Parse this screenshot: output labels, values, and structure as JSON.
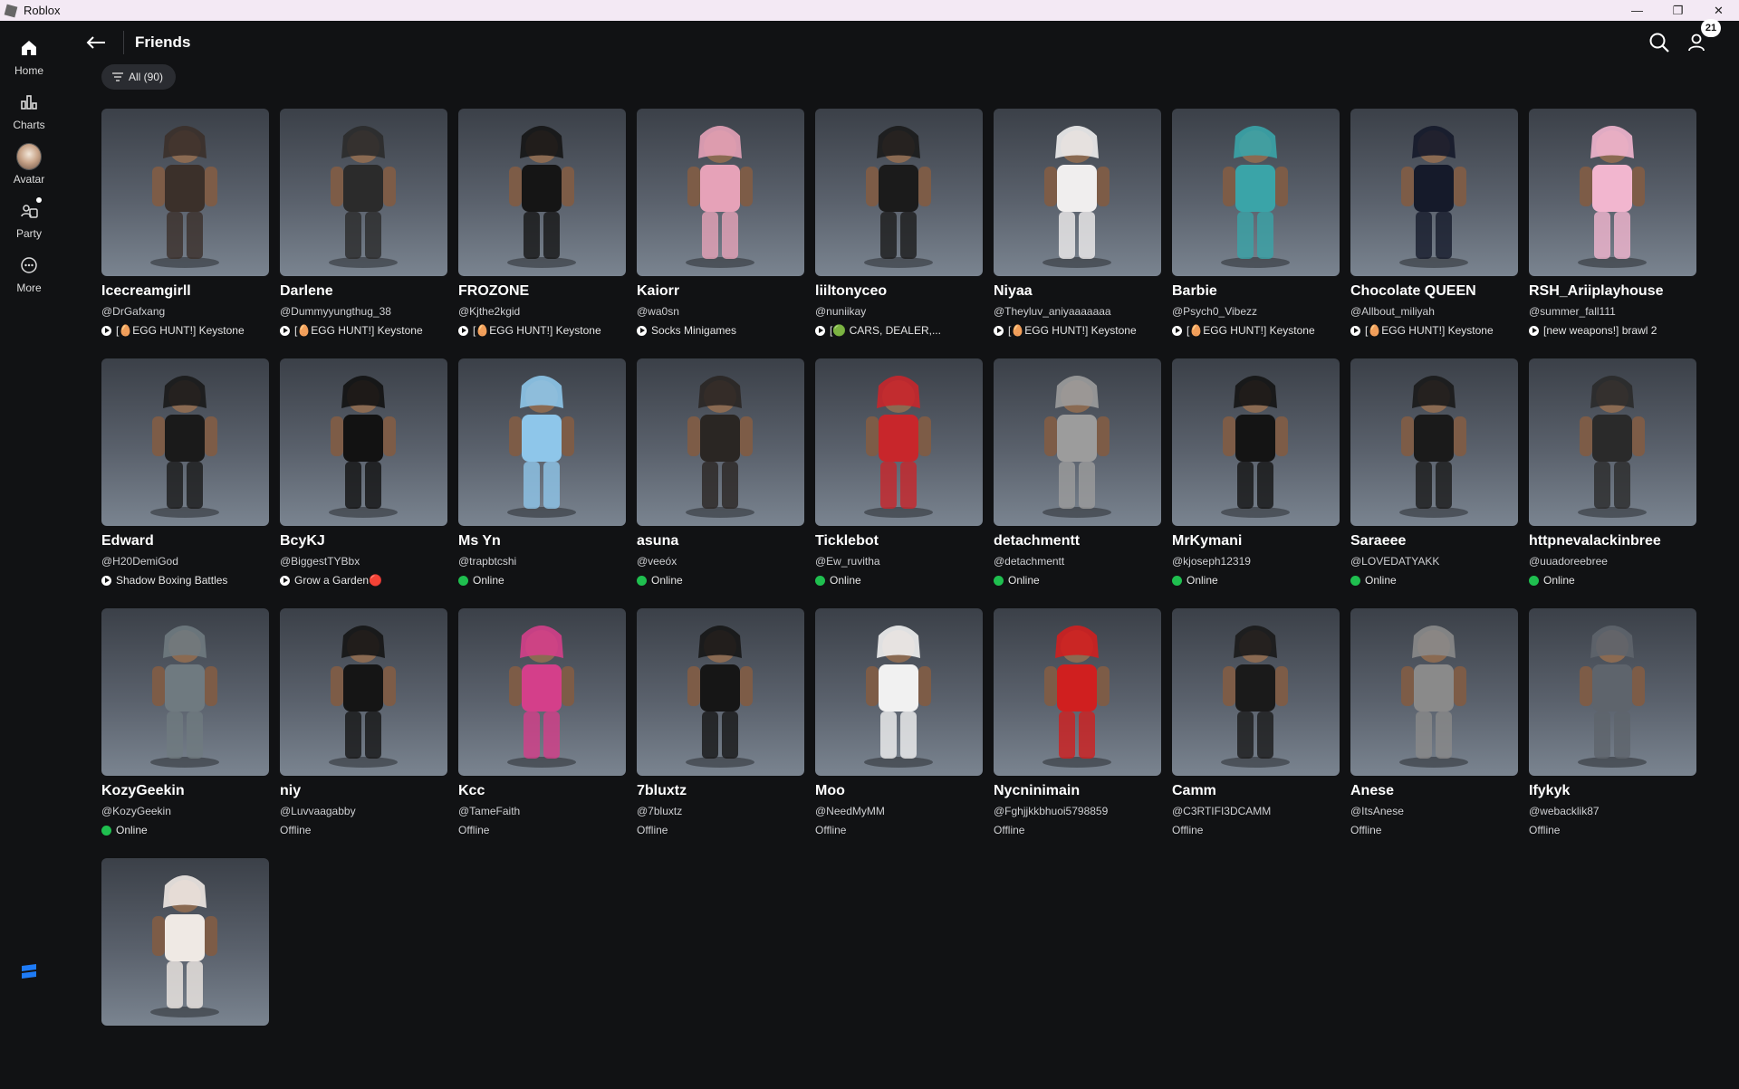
{
  "window": {
    "title": "Roblox",
    "controls": [
      "—",
      "❐",
      "✕"
    ]
  },
  "sidebar": {
    "items": [
      {
        "id": "home",
        "label": "Home",
        "icon": "home-icon"
      },
      {
        "id": "charts",
        "label": "Charts",
        "icon": "charts-icon"
      },
      {
        "id": "avatar",
        "label": "Avatar",
        "icon": "avatar-icon"
      },
      {
        "id": "party",
        "label": "Party",
        "icon": "party-icon"
      },
      {
        "id": "more",
        "label": "More",
        "icon": "more-icon"
      }
    ]
  },
  "header": {
    "title": "Friends",
    "notification_count": "21"
  },
  "filter": {
    "label": "All (90)"
  },
  "friends": [
    {
      "name": "Icecreamgirll",
      "username": "@DrGafxang",
      "status": "playing",
      "status_text": "[🥚EGG HUNT!] Keystone",
      "color": "#3b302a"
    },
    {
      "name": "Darlene",
      "username": "@Dummyyungthug_38",
      "status": "playing",
      "status_text": "[🥚EGG HUNT!] Keystone",
      "color": "#2b2b2b"
    },
    {
      "name": "FROZONE",
      "username": "@Kjthe2kgid",
      "status": "playing",
      "status_text": "[🥚EGG HUNT!] Keystone",
      "color": "#151515"
    },
    {
      "name": "Kaiorr",
      "username": "@wa0sn",
      "status": "playing",
      "status_text": "Socks Minigames",
      "color": "#e6a2b8"
    },
    {
      "name": "liiltonyceo",
      "username": "@nuniikay",
      "status": "playing",
      "status_text": "[🟢 CARS, DEALER,...",
      "color": "#1b1b1b"
    },
    {
      "name": "Niyaa",
      "username": "@Theyluv_aniyaaaaaaa",
      "status": "playing",
      "status_text": "[🥚EGG HUNT!] Keystone",
      "color": "#f0eeee"
    },
    {
      "name": "Barbie",
      "username": "@Psych0_Vibezz",
      "status": "playing",
      "status_text": "[🥚EGG HUNT!] Keystone",
      "color": "#3aa4a8"
    },
    {
      "name": "Chocolate QUEEN",
      "username": "@Allbout_miliyah",
      "status": "playing",
      "status_text": "[🥚EGG HUNT!] Keystone",
      "color": "#151a2a"
    },
    {
      "name": "RSH_Ariiplayhouse",
      "username": "@summer_fall111",
      "status": "playing",
      "status_text": "[new weapons!] brawl 2",
      "color": "#f2b6cf"
    },
    {
      "name": "Edward",
      "username": "@H20DemiGod",
      "status": "playing",
      "status_text": "Shadow Boxing Battles",
      "color": "#1a1a1a"
    },
    {
      "name": "BcyKJ",
      "username": "@BiggestTYBbx",
      "status": "playing",
      "status_text": "Grow a Garden🔴",
      "color": "#121212"
    },
    {
      "name": "Ms Yn",
      "username": "@trapbtcshi",
      "status": "online",
      "status_text": "Online",
      "color": "#8ec6ea"
    },
    {
      "name": "asuna",
      "username": "@veeóx",
      "status": "online",
      "status_text": "Online",
      "color": "#2a2623"
    },
    {
      "name": "Ticklebot",
      "username": "@Ew_ruvitha",
      "status": "online",
      "status_text": "Online",
      "color": "#c8262b"
    },
    {
      "name": "detachmentt",
      "username": "@detachmentt",
      "status": "online",
      "status_text": "Online",
      "color": "#9c9c9c"
    },
    {
      "name": "MrKymani",
      "username": "@kjoseph12319",
      "status": "online",
      "status_text": "Online",
      "color": "#141414"
    },
    {
      "name": "Saraeee",
      "username": "@LOVEDATYAKK",
      "status": "online",
      "status_text": "Online",
      "color": "#1a1a1a"
    },
    {
      "name": "httpnevalackinbree",
      "username": "@uuadoreebree",
      "status": "online",
      "status_text": "Online",
      "color": "#2a2a2a"
    },
    {
      "name": "KozyGeekin",
      "username": "@KozyGeekin",
      "status": "online",
      "status_text": "Online",
      "color": "#6f7a80"
    },
    {
      "name": "niy",
      "username": "@Luvvaagabby",
      "status": "offline",
      "status_text": "Offline",
      "color": "#151515"
    },
    {
      "name": "Kcc",
      "username": "@TameFaith",
      "status": "offline",
      "status_text": "Offline",
      "color": "#d43f8a"
    },
    {
      "name": "7bluxtz",
      "username": "@7bluxtz",
      "status": "offline",
      "status_text": "Offline",
      "color": "#161616"
    },
    {
      "name": "Moo",
      "username": "@NeedMyMM",
      "status": "offline",
      "status_text": "Offline",
      "color": "#f1f1f1"
    },
    {
      "name": "Nycninimain",
      "username": "@Fghjjkkbhuoi5798859",
      "status": "offline",
      "status_text": "Offline",
      "color": "#d01f1f"
    },
    {
      "name": "Camm",
      "username": "@C3RTIFI3DCAMM",
      "status": "offline",
      "status_text": "Offline",
      "color": "#1a1a1a"
    },
    {
      "name": "Anese",
      "username": "@ItsAnese",
      "status": "offline",
      "status_text": "Offline",
      "color": "#8a8a8a"
    },
    {
      "name": "Ifykyk",
      "username": "@webacklik87",
      "status": "offline",
      "status_text": "Offline",
      "color": "#5e646c"
    },
    {
      "name": "",
      "username": "",
      "status": "none",
      "status_text": "",
      "color": "#efe9e4"
    }
  ]
}
